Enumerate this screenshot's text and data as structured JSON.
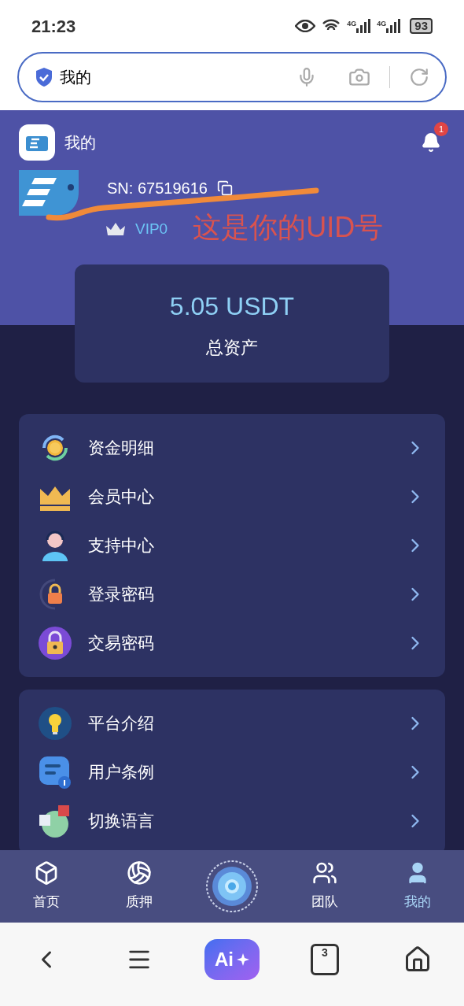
{
  "status_bar": {
    "time": "21:23",
    "network_1": "4G",
    "network_2": "4G",
    "battery": "93"
  },
  "address_bar": {
    "value": "我的"
  },
  "header": {
    "title": "我的",
    "notifications": "1"
  },
  "profile": {
    "sn": "SN: 67519616",
    "vip": "VIP0"
  },
  "annotation": {
    "text": "这是你的UID号"
  },
  "balance": {
    "amount": "5.05 USDT",
    "label": "总资产"
  },
  "menu_groups": [
    {
      "items": [
        {
          "label": "资金明细"
        },
        {
          "label": "会员中心"
        },
        {
          "label": "支持中心"
        },
        {
          "label": "登录密码"
        },
        {
          "label": "交易密码"
        }
      ]
    },
    {
      "items": [
        {
          "label": "平台介绍"
        },
        {
          "label": "用户条例"
        },
        {
          "label": "切换语言"
        }
      ]
    }
  ],
  "tab_bar": [
    {
      "kind": "tab",
      "label": "首页",
      "selected": false
    },
    {
      "kind": "tab",
      "label": "质押",
      "selected": false
    },
    {
      "kind": "center"
    },
    {
      "kind": "tab",
      "label": "团队",
      "selected": false
    },
    {
      "kind": "tab",
      "label": "我的",
      "selected": true
    }
  ],
  "browser_toolbar": {
    "ai_label": "Ai",
    "tab_count": "3"
  }
}
